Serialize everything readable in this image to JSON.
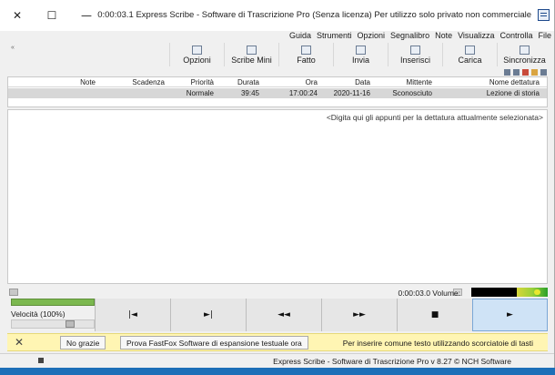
{
  "window": {
    "title": "0:00:03.1 Express Scribe - Software di Trascrizione Pro (Senza licenza) Per utilizzo solo privato non commerciale",
    "controls": {
      "close": "✕",
      "maximize": "☐",
      "minimize": "—"
    }
  },
  "menu": [
    "File",
    "Controlla",
    "Visualizza",
    "Note",
    "Segnalibro",
    "Opzioni",
    "Strumenti",
    "Guida"
  ],
  "toolbar": {
    "left_marker": "«",
    "buttons": [
      {
        "label": "Sincronizza",
        "icon": "sync-icon"
      },
      {
        "label": "Carica",
        "icon": "upload-icon"
      },
      {
        "label": "Inserisci",
        "icon": "insert-icon"
      },
      {
        "label": "Invia",
        "icon": "send-icon"
      },
      {
        "label": "Fatto",
        "icon": "done-icon"
      },
      {
        "label": "Scribe Mini",
        "icon": "mini-icon"
      },
      {
        "label": "Opzioni",
        "icon": "options-icon"
      }
    ]
  },
  "table": {
    "headers": [
      "Nome dettatura",
      "Mittente",
      "Data",
      "Ora",
      "Durata",
      "Priorità",
      "Scadenza",
      "Note"
    ],
    "rows": [
      [
        "Lezione di storia",
        "Sconosciuto",
        "2020-11-16",
        "17:00:24",
        "39:45",
        "Normale",
        "",
        ""
      ]
    ]
  },
  "notes": {
    "placeholder": "<Digita qui gli appunti per la dettatura attualmente selezionata>"
  },
  "position": {
    "time_volume": "0:00:03.0 Volume:"
  },
  "left_panel": {
    "speed": "Velocità (100%)",
    "speed_value_percent": 100,
    "volume_level": 1.0
  },
  "level_meter": {
    "level": 0.4
  },
  "transport": [
    {
      "label": "►",
      "name": "play-button",
      "active": true
    },
    {
      "label": "■",
      "name": "stop-button",
      "active": false
    },
    {
      "label": "►►",
      "name": "fast-forward-button",
      "active": false
    },
    {
      "label": "◄◄",
      "name": "rewind-button",
      "active": false
    },
    {
      "label": "►|",
      "name": "skip-end-button",
      "active": false
    },
    {
      "label": "|◄",
      "name": "skip-start-button",
      "active": false
    }
  ],
  "notice": {
    "message": "Per inserire comune testo utilizzando scorciatoie di tasti",
    "try_button": "Prova FastFox Software di espansione testuale ora",
    "no_button": "No grazie",
    "close": "✕"
  },
  "status": {
    "text": "Express Scribe - Software di Trascrizione Pro v 8.27 © NCH Software"
  },
  "colors": {
    "accent": "#1d6fb8",
    "notice_bg": "#fff5b3",
    "selected_row": "#d7d7d7"
  }
}
